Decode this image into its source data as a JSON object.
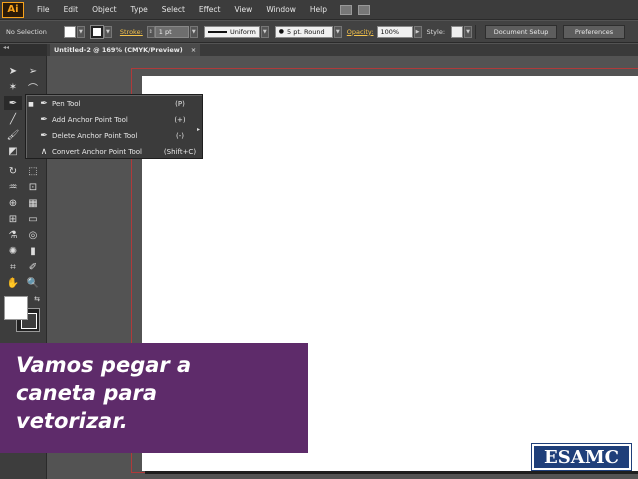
{
  "app": {
    "logo": "Ai"
  },
  "menu": [
    "File",
    "Edit",
    "Object",
    "Type",
    "Select",
    "Effect",
    "View",
    "Window",
    "Help"
  ],
  "control_bar": {
    "selection_label": "No Selection",
    "stroke_label": "Stroke:",
    "stroke_weight": "1 pt",
    "stroke_profile": "Uniform",
    "brush": "5 pt. Round",
    "opacity_label": "Opacity:",
    "opacity_value": "100%",
    "style_label": "Style:",
    "document_setup": "Document Setup",
    "preferences": "Preferences"
  },
  "document_tab": {
    "title": "Untitled-2 @ 169% (CMYK/Preview)",
    "close": "×"
  },
  "flyout": {
    "items": [
      {
        "label": "Pen Tool",
        "shortcut": "(P)",
        "icon": "pen-icon"
      },
      {
        "label": "Add Anchor Point Tool",
        "shortcut": "(+)",
        "icon": "add-anchor-icon"
      },
      {
        "label": "Delete Anchor Point Tool",
        "shortcut": "(-)",
        "icon": "delete-anchor-icon"
      },
      {
        "label": "Convert Anchor Point Tool",
        "shortcut": "(Shift+C)",
        "icon": "convert-anchor-icon"
      }
    ]
  },
  "caption": {
    "line1": "Vamos pegar a",
    "line2": "caneta para",
    "line3": "vetorizar."
  },
  "brand": {
    "logo_text": "ESAMC",
    "color": "#1f3f7a"
  },
  "colors": {
    "caption_bg": "#5e2b6a",
    "accent": "#f7a21b",
    "bleed": "#b03a3a"
  }
}
